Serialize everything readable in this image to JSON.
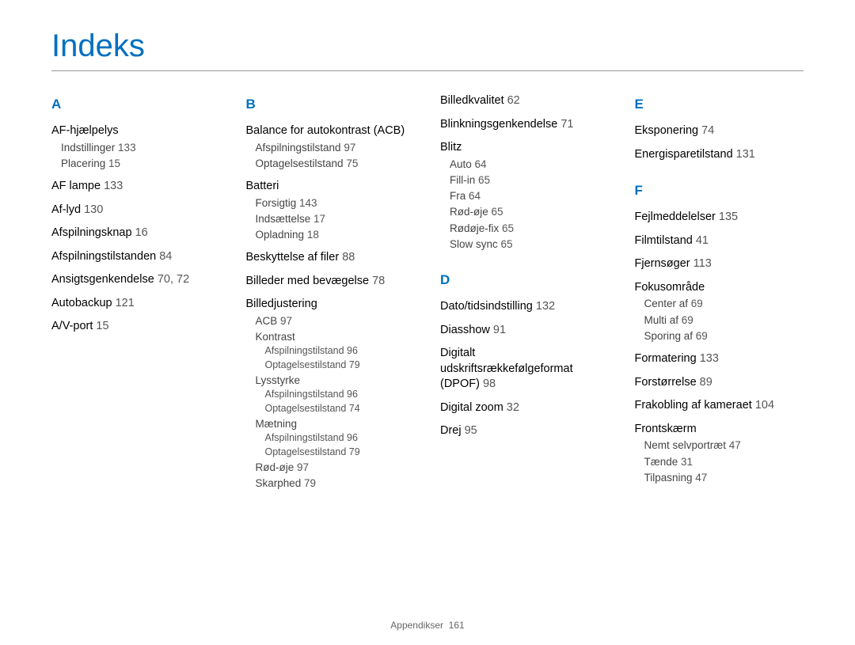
{
  "title": "Indeks",
  "footer": {
    "label": "Appendikser",
    "page": "161"
  },
  "columns": [
    {
      "groups": [
        {
          "letter": "A",
          "items": [
            {
              "term": "AF-hjælpelys",
              "sub": [
                {
                  "term": "Indstillinger",
                  "pg": "133"
                },
                {
                  "term": "Placering",
                  "pg": "15"
                }
              ]
            },
            {
              "term": "AF lampe",
              "pg": "133"
            },
            {
              "term": "Af-lyd",
              "pg": "130"
            },
            {
              "term": "Afspilningsknap",
              "pg": "16"
            },
            {
              "term": "Afspilningstilstanden",
              "pg": "84"
            },
            {
              "term": "Ansigtsgenkendelse",
              "pg": "70, 72"
            },
            {
              "term": "Autobackup",
              "pg": "121"
            },
            {
              "term": "A/V-port",
              "pg": "15"
            }
          ]
        }
      ]
    },
    {
      "groups": [
        {
          "letter": "B",
          "items": [
            {
              "term": "Balance for autokontrast (ACB)",
              "sub": [
                {
                  "term": "Afspilningstilstand",
                  "pg": "97"
                },
                {
                  "term": "Optagelsestilstand",
                  "pg": "75"
                }
              ]
            },
            {
              "term": "Batteri",
              "sub": [
                {
                  "term": "Forsigtig",
                  "pg": "143"
                },
                {
                  "term": "Indsættelse",
                  "pg": "17"
                },
                {
                  "term": "Opladning",
                  "pg": "18"
                }
              ]
            },
            {
              "term": "Beskyttelse af filer",
              "pg": "88"
            },
            {
              "term": "Billeder med bevægelse",
              "pg": "78"
            },
            {
              "term": "Billedjustering",
              "sub": [
                {
                  "term": "ACB",
                  "pg": "97"
                },
                {
                  "term": "Kontrast",
                  "subsub": [
                    {
                      "term": "Afspilningstilstand",
                      "pg": "96"
                    },
                    {
                      "term": "Optagelsestilstand",
                      "pg": "79"
                    }
                  ]
                },
                {
                  "term": "Lysstyrke",
                  "subsub": [
                    {
                      "term": "Afspilningstilstand",
                      "pg": "96"
                    },
                    {
                      "term": "Optagelsestilstand",
                      "pg": "74"
                    }
                  ]
                },
                {
                  "term": "Mætning",
                  "subsub": [
                    {
                      "term": "Afspilningstilstand",
                      "pg": "96"
                    },
                    {
                      "term": "Optagelsestilstand",
                      "pg": "79"
                    }
                  ]
                },
                {
                  "term": "Rød-øje",
                  "pg": "97"
                },
                {
                  "term": "Skarphed",
                  "pg": "79"
                }
              ]
            }
          ]
        }
      ]
    },
    {
      "groups": [
        {
          "continuation": true,
          "items": [
            {
              "term": "Billedkvalitet",
              "pg": "62"
            },
            {
              "term": "Blinkningsgenkendelse",
              "pg": "71"
            },
            {
              "term": "Blitz",
              "sub": [
                {
                  "term": "Auto",
                  "pg": "64"
                },
                {
                  "term": "Fill-in",
                  "pg": "65"
                },
                {
                  "term": "Fra",
                  "pg": "64"
                },
                {
                  "term": "Rød-øje",
                  "pg": "65"
                },
                {
                  "term": "Rødøje-fix",
                  "pg": "65"
                },
                {
                  "term": "Slow sync",
                  "pg": "65"
                }
              ]
            }
          ]
        },
        {
          "letter": "D",
          "items": [
            {
              "term": "Dato/tidsindstilling",
              "pg": "132"
            },
            {
              "term": "Diasshow",
              "pg": "91"
            },
            {
              "term": "Digitalt udskriftsrækkefølgeformat (DPOF)",
              "pg": "98"
            },
            {
              "term": "Digital zoom",
              "pg": "32"
            },
            {
              "term": "Drej",
              "pg": "95"
            }
          ]
        }
      ]
    },
    {
      "groups": [
        {
          "letter": "E",
          "items": [
            {
              "term": "Eksponering",
              "pg": "74"
            },
            {
              "term": "Energisparetilstand",
              "pg": "131"
            }
          ]
        },
        {
          "letter": "F",
          "items": [
            {
              "term": "Fejlmeddelelser",
              "pg": "135"
            },
            {
              "term": "Filmtilstand",
              "pg": "41"
            },
            {
              "term": "Fjernsøger",
              "pg": "113"
            },
            {
              "term": "Fokusområde",
              "sub": [
                {
                  "term": "Center af",
                  "pg": "69"
                },
                {
                  "term": "Multi af",
                  "pg": "69"
                },
                {
                  "term": "Sporing af",
                  "pg": "69"
                }
              ]
            },
            {
              "term": "Formatering",
              "pg": "133"
            },
            {
              "term": "Forstørrelse",
              "pg": "89"
            },
            {
              "term": "Frakobling af kameraet",
              "pg": "104"
            },
            {
              "term": "Frontskærm",
              "sub": [
                {
                  "term": "Nemt selvportræt",
                  "pg": "47"
                },
                {
                  "term": "Tænde",
                  "pg": "31"
                },
                {
                  "term": "Tilpasning",
                  "pg": "47"
                }
              ]
            }
          ]
        }
      ]
    }
  ]
}
